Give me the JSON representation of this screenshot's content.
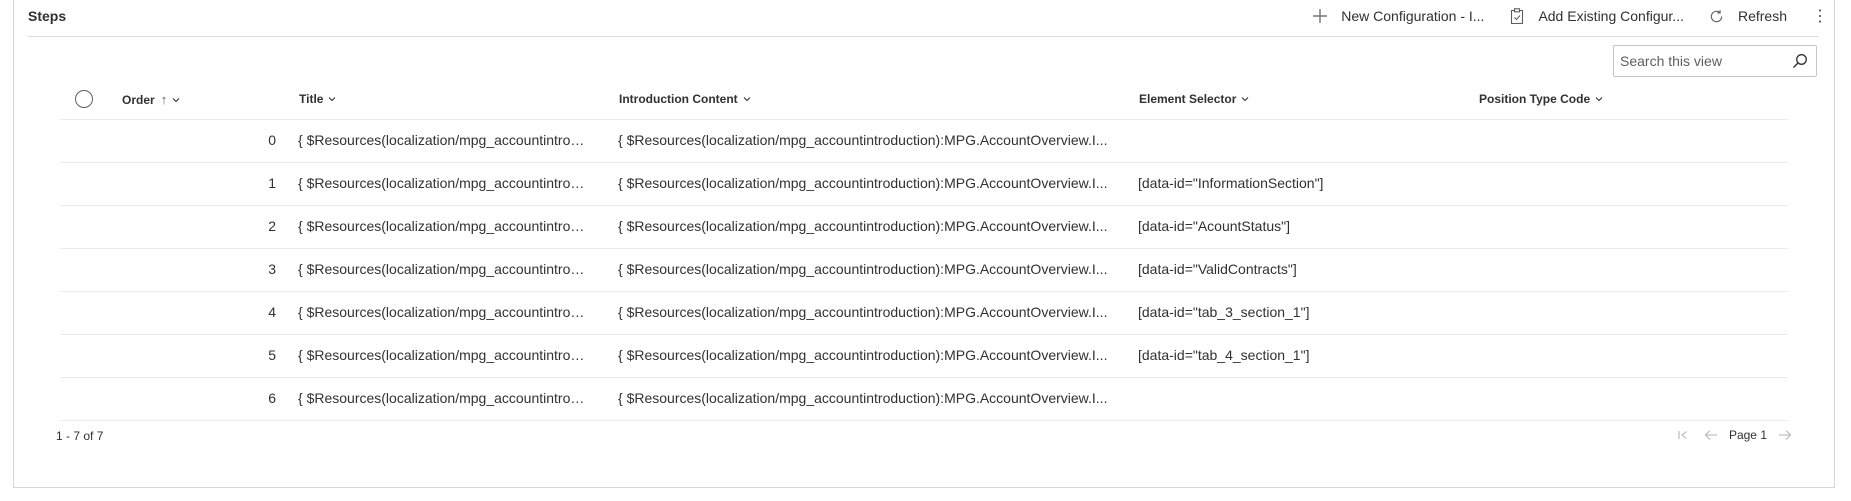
{
  "section": {
    "title": "Steps"
  },
  "commands": {
    "new_config": "New Configuration - I...",
    "add_existing": "Add Existing Configur...",
    "refresh": "Refresh"
  },
  "search": {
    "placeholder": "Search this view",
    "value": ""
  },
  "columns": {
    "order": "Order",
    "title": "Title",
    "intro": "Introduction Content",
    "element": "Element Selector",
    "position": "Position Type Code"
  },
  "rows": [
    {
      "order": "0",
      "title": "{ $Resources(localization/mpg_accountintrod...",
      "intro": "{ $Resources(localization/mpg_accountintroduction):MPG.AccountOverview.I...",
      "element": "",
      "position": ""
    },
    {
      "order": "1",
      "title": "{ $Resources(localization/mpg_accountintrod...",
      "intro": "{ $Resources(localization/mpg_accountintroduction):MPG.AccountOverview.I...",
      "element": "[data-id=\"InformationSection\"]",
      "position": ""
    },
    {
      "order": "2",
      "title": "{ $Resources(localization/mpg_accountintrod...",
      "intro": "{ $Resources(localization/mpg_accountintroduction):MPG.AccountOverview.I...",
      "element": "[data-id=\"AcountStatus\"]",
      "position": ""
    },
    {
      "order": "3",
      "title": "{ $Resources(localization/mpg_accountintrod...",
      "intro": "{ $Resources(localization/mpg_accountintroduction):MPG.AccountOverview.I...",
      "element": "[data-id=\"ValidContracts\"]",
      "position": ""
    },
    {
      "order": "4",
      "title": "{ $Resources(localization/mpg_accountintrod...",
      "intro": "{ $Resources(localization/mpg_accountintroduction):MPG.AccountOverview.I...",
      "element": "[data-id=\"tab_3_section_1\"]",
      "position": ""
    },
    {
      "order": "5",
      "title": "{ $Resources(localization/mpg_accountintrod...",
      "intro": "{ $Resources(localization/mpg_accountintroduction):MPG.AccountOverview.I...",
      "element": "[data-id=\"tab_4_section_1\"]",
      "position": ""
    },
    {
      "order": "6",
      "title": "{ $Resources(localization/mpg_accountintrod...",
      "intro": "{ $Resources(localization/mpg_accountintroduction):MPG.AccountOverview.I...",
      "element": "",
      "position": ""
    }
  ],
  "footer": {
    "count": "1 - 7 of 7",
    "page": "Page 1"
  },
  "icons": {
    "add": "plus-icon",
    "add_existing": "clipboard-icon",
    "refresh": "refresh-icon",
    "more": "more-vertical-icon",
    "search": "search-icon",
    "sort": "sort-ascending-icon",
    "chevron": "chevron-down-icon",
    "first": "first-page-icon",
    "prev": "previous-page-icon",
    "next": "next-page-icon"
  }
}
